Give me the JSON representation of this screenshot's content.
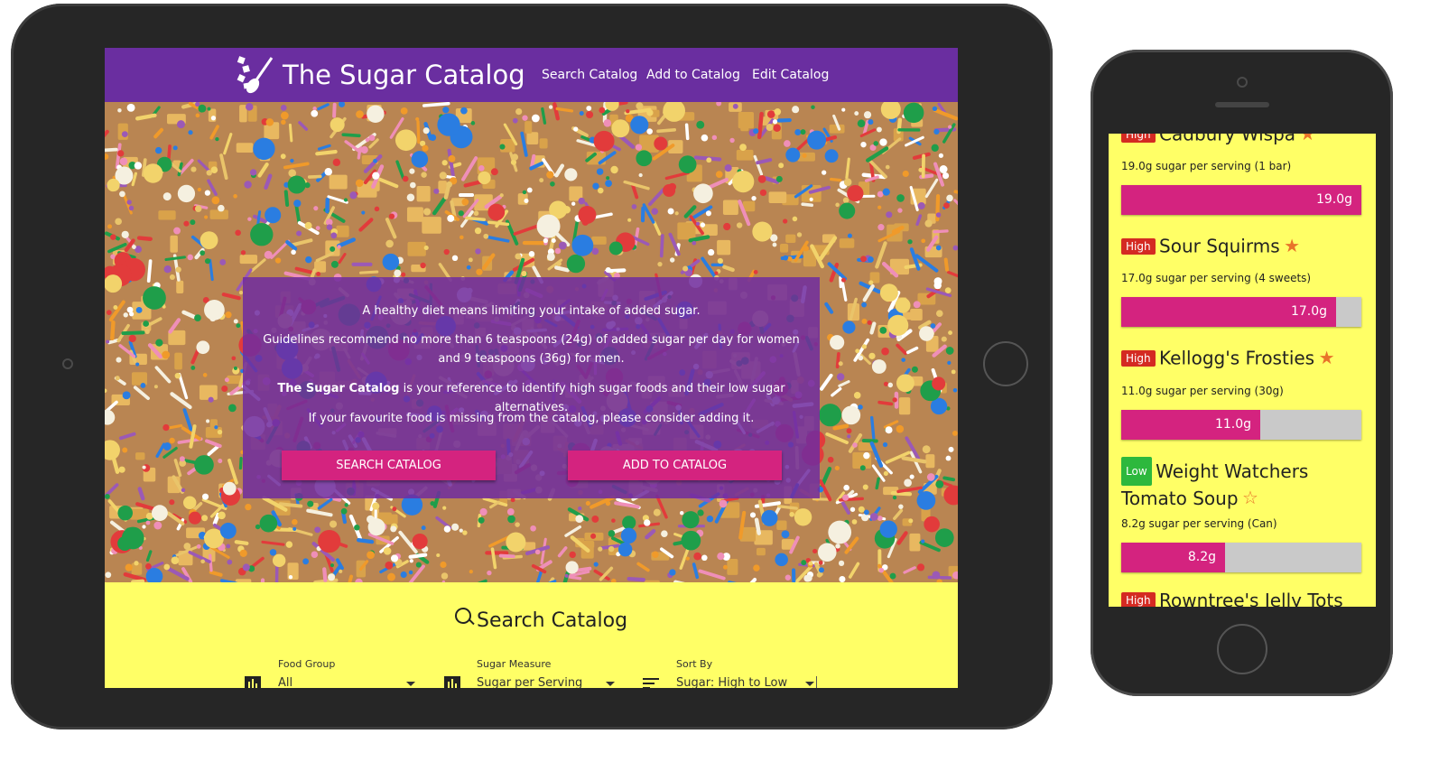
{
  "tablet": {
    "nav": {
      "brand": "The Sugar Catalog",
      "links": [
        "Search Catalog",
        "Add to Catalog",
        "Edit Catalog"
      ]
    },
    "hero": {
      "line1": "A healthy diet means limiting your intake of added sugar.",
      "line2": "Guidelines recommend no more than 6 teaspoons (24g) of added sugar per day for women and 9 teaspoons (36g) for men.",
      "line3_bold": "The Sugar Catalog",
      "line3_rest": " is your reference to identify high sugar foods and their low sugar alternatives.",
      "line4": "If your favourite food is missing from the catalog, please consider adding it.",
      "btn_search": "SEARCH CATALOG",
      "btn_add": "ADD TO CATALOG"
    },
    "search": {
      "title": "Search Catalog",
      "filters": [
        {
          "label": "Food Group",
          "value": "All",
          "icon": "bar-chart-icon"
        },
        {
          "label": "Sugar Measure",
          "value": "Sugar per Serving",
          "icon": "bar-chart-icon"
        },
        {
          "label": "Sort By",
          "value": "Sugar: High to Low",
          "icon": "sort-icon"
        }
      ]
    }
  },
  "phone": {
    "max_sugar": 19.0,
    "items": [
      {
        "badge": "High",
        "name": "Cadbury Wispa",
        "star": "★",
        "serving": "19.0g sugar per serving (1 bar)",
        "sugar": 19.0,
        "label": "19.0g"
      },
      {
        "badge": "High",
        "name": "Sour Squirms",
        "star": "★",
        "serving": "17.0g sugar per serving (4 sweets)",
        "sugar": 17.0,
        "label": "17.0g"
      },
      {
        "badge": "High",
        "name": "Kellogg's Frosties",
        "star": "★",
        "serving": "11.0g sugar per serving (30g)",
        "sugar": 11.0,
        "label": "11.0g"
      },
      {
        "badge": "Low",
        "name": "Weight Watchers Tomato Soup",
        "star": "☆",
        "serving": "8.2g sugar per serving (Can)",
        "sugar": 8.2,
        "label": "8.2g"
      },
      {
        "badge": "High",
        "name": "Rowntree's Jelly Tots",
        "star": "",
        "serving": "",
        "sugar": null,
        "label": ""
      }
    ]
  },
  "colors": {
    "nav_purple": "#6a2ea0",
    "accent_pink": "#d4237f",
    "page_yellow": "#ffff66",
    "badge_high": "#d42a22",
    "badge_low": "#2db83d",
    "star": "#e8732a"
  }
}
